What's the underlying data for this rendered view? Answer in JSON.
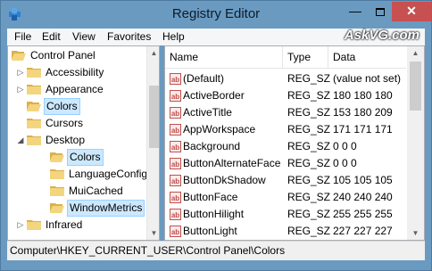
{
  "window": {
    "title": "Registry Editor",
    "close_glyph": "✕",
    "minimize_glyph": "—"
  },
  "menu": [
    "File",
    "Edit",
    "View",
    "Favorites",
    "Help"
  ],
  "watermark": "AskVG.com",
  "tree": {
    "root": "Control Panel",
    "items": [
      {
        "label": "Accessibility",
        "depth": 1,
        "arrow": "▷",
        "selected": false
      },
      {
        "label": "Appearance",
        "depth": 1,
        "arrow": "▷",
        "selected": false
      },
      {
        "label": "Colors",
        "depth": 1,
        "arrow": "",
        "selected": true
      },
      {
        "label": "Cursors",
        "depth": 1,
        "arrow": "",
        "selected": false
      },
      {
        "label": "Desktop",
        "depth": 1,
        "arrow": "◢",
        "selected": false
      },
      {
        "label": "Colors",
        "depth": 2,
        "arrow": "",
        "selected": true
      },
      {
        "label": "LanguageConfig",
        "depth": 2,
        "arrow": "",
        "selected": false
      },
      {
        "label": "MuiCached",
        "depth": 2,
        "arrow": "",
        "selected": false
      },
      {
        "label": "WindowMetrics",
        "depth": 2,
        "arrow": "",
        "selected": true
      },
      {
        "label": "Infrared",
        "depth": 1,
        "arrow": "▷",
        "selected": false
      }
    ]
  },
  "list": {
    "columns": [
      "Name",
      "Type",
      "Data"
    ],
    "rows": [
      {
        "name": "(Default)",
        "type": "REG_SZ",
        "data": "(value not set)"
      },
      {
        "name": "ActiveBorder",
        "type": "REG_SZ",
        "data": "180 180 180"
      },
      {
        "name": "ActiveTitle",
        "type": "REG_SZ",
        "data": "153 180 209"
      },
      {
        "name": "AppWorkspace",
        "type": "REG_SZ",
        "data": "171 171 171"
      },
      {
        "name": "Background",
        "type": "REG_SZ",
        "data": "0 0 0"
      },
      {
        "name": "ButtonAlternateFace",
        "type": "REG_SZ",
        "data": "0 0 0"
      },
      {
        "name": "ButtonDkShadow",
        "type": "REG_SZ",
        "data": "105 105 105"
      },
      {
        "name": "ButtonFace",
        "type": "REG_SZ",
        "data": "240 240 240"
      },
      {
        "name": "ButtonHilight",
        "type": "REG_SZ",
        "data": "255 255 255"
      },
      {
        "name": "ButtonLight",
        "type": "REG_SZ",
        "data": "227 227 227"
      }
    ]
  },
  "status": "Computer\\HKEY_CURRENT_USER\\Control Panel\\Colors"
}
